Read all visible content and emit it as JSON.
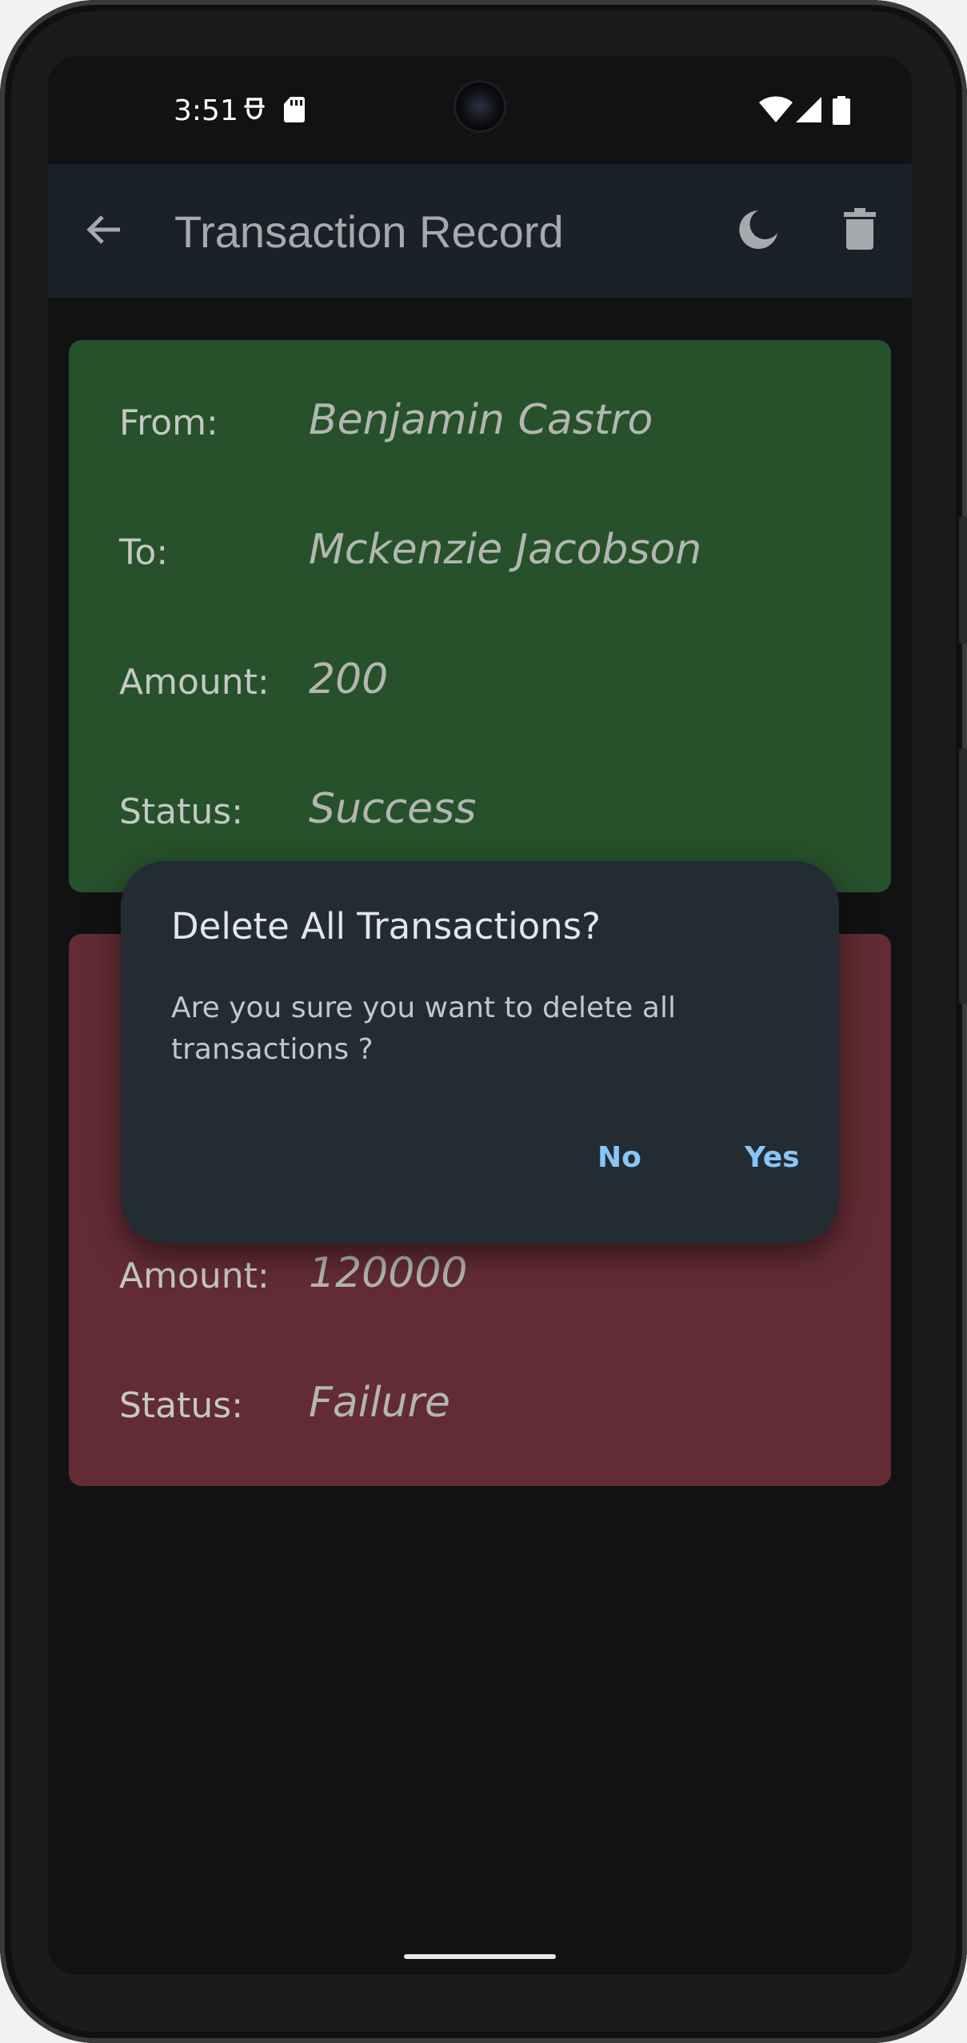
{
  "status_bar": {
    "time": "3:51",
    "icons": [
      "face-icon",
      "sd-card-icon",
      "wifi-icon",
      "signal-icon",
      "battery-icon"
    ]
  },
  "app_bar": {
    "title": "Transaction Record",
    "back_icon": "arrow-back-icon",
    "theme_icon": "moon-icon",
    "delete_icon": "trash-icon"
  },
  "transactions": [
    {
      "status_color": "#27512a",
      "from_label": "From:",
      "from": "Benjamin Castro",
      "to_label": "To:",
      "to": "Mckenzie Jacobson",
      "amount_label": "Amount:",
      "amount": "200",
      "status_label": "Status:",
      "status": "Success"
    },
    {
      "status_color": "#632c33",
      "amount_label": "Amount:",
      "amount": "120000",
      "status_label": "Status:",
      "status": "Failure"
    }
  ],
  "dialog": {
    "title": "Delete All Transactions?",
    "message": "Are you sure you want to delete all transactions ?",
    "no_label": "No",
    "yes_label": "Yes"
  }
}
